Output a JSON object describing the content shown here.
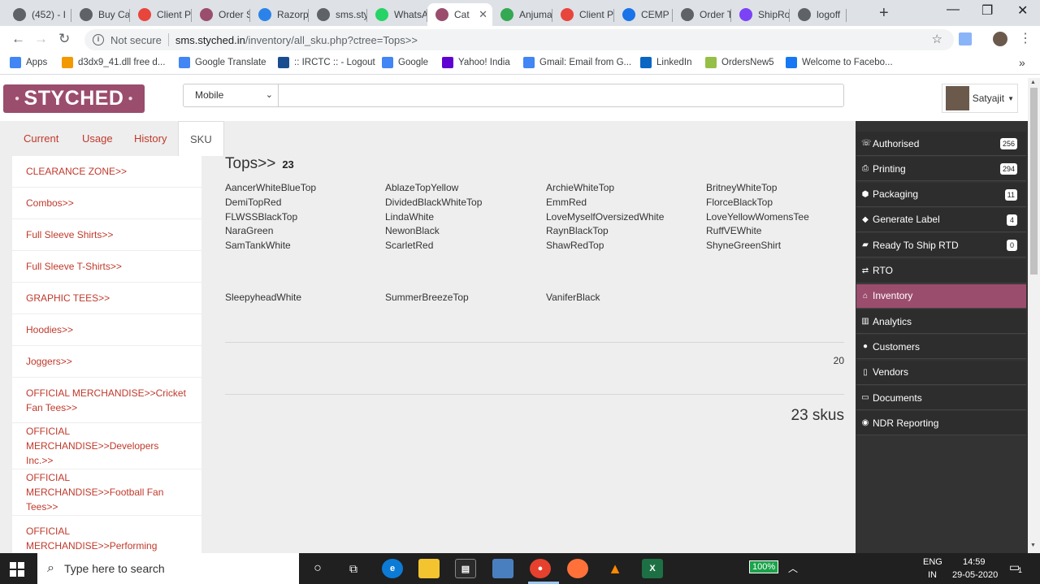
{
  "browser": {
    "tabs": [
      {
        "title": "(452) - I",
        "icon": "mail-icon",
        "color": "#5f6368"
      },
      {
        "title": "Buy Cas",
        "icon": "globe-icon",
        "color": "#5f6368"
      },
      {
        "title": "Client P",
        "icon": "client-icon",
        "color": "#e8453c"
      },
      {
        "title": "Order S",
        "icon": "styched-icon",
        "color": "#9b4d6d"
      },
      {
        "title": "Razorpa",
        "icon": "razorpay-icon",
        "color": "#2b83ea"
      },
      {
        "title": "sms.sty",
        "icon": "globe-icon",
        "color": "#5f6368"
      },
      {
        "title": "WhatsA",
        "icon": "whatsapp-icon",
        "color": "#25d366"
      },
      {
        "title": "Cat",
        "icon": "styched-icon",
        "color": "#9b4d6d"
      },
      {
        "title": "Anjuma",
        "icon": "maps-pin-icon",
        "color": "#34a853"
      },
      {
        "title": "Client P",
        "icon": "client-icon",
        "color": "#e8453c"
      },
      {
        "title": "CEMP",
        "icon": "cemp-icon",
        "color": "#1a73e8"
      },
      {
        "title": "Order T",
        "icon": "globe-icon",
        "color": "#5f6368"
      },
      {
        "title": "ShipRo",
        "icon": "shiprocket-icon",
        "color": "#7b42f6"
      },
      {
        "title": "logoff",
        "icon": "globe-icon",
        "color": "#5f6368"
      }
    ],
    "new_tab": "+",
    "window_controls": {
      "minimize": "—",
      "maximize": "❐",
      "close": "✕"
    },
    "address": {
      "not_secure": "Not secure",
      "host": "sms.styched.in",
      "path": "/inventory/all_sku.php?ctree=Tops>>"
    },
    "bookmarks": [
      {
        "label": "Apps",
        "icon": "apps-grid-icon",
        "color": "#4285f4"
      },
      {
        "label": "d3dx9_41.dll free d...",
        "icon": "gear-icon",
        "color": "#f29900"
      },
      {
        "label": "Google Translate",
        "icon": "translate-icon",
        "color": "#4285f4"
      },
      {
        "label": ":: IRCTC :: - Logout",
        "icon": "irctc-icon",
        "color": "#1a4d8f"
      },
      {
        "label": "Google",
        "icon": "google-icon",
        "color": "#4285f4"
      },
      {
        "label": "Yahoo! India",
        "icon": "yahoo-icon",
        "color": "#5f01d1"
      },
      {
        "label": "Gmail: Email from G...",
        "icon": "google-icon",
        "color": "#4285f4"
      },
      {
        "label": "LinkedIn",
        "icon": "linkedin-icon",
        "color": "#0a66c2"
      },
      {
        "label": "OrdersNew5",
        "icon": "shopify-icon",
        "color": "#95bf47"
      },
      {
        "label": "Welcome to Facebo...",
        "icon": "facebook-icon",
        "color": "#1877f2"
      }
    ],
    "more_bookmarks": "»"
  },
  "app": {
    "logo": "STYCHED",
    "search_type": "Mobile",
    "search_value": "",
    "user_name": "Satyajit"
  },
  "nav_tabs": [
    "Current",
    "Usage",
    "History",
    "SKU List"
  ],
  "categories": [
    "CLEARANCE ZONE>>",
    "Combos>>",
    "Full Sleeve Shirts>>",
    "Full Sleeve T-Shirts>>",
    "GRAPHIC TEES>>",
    "Hoodies>>",
    "Joggers>>",
    "OFFICIAL MERCHANDISE>>Cricket Fan Tees>>",
    "OFFICIAL MERCHANDISE>>Developers Inc.>>",
    "OFFICIAL MERCHANDISE>>Football Fan Tees>>",
    "OFFICIAL MERCHANDISE>>Performing"
  ],
  "sku_panel": {
    "title": "Tops>>",
    "count": "23",
    "group1": [
      "AancerWhiteBlueTop",
      "AblazeTopYellow",
      "ArchieWhiteTop",
      "BritneyWhiteTop",
      "DemiTopRed",
      "DividedBlackWhiteTop",
      "EmmRed",
      "FlorceBlackTop",
      "FLWSSBlackTop",
      "LindaWhite",
      "LoveMyselfOversizedWhite",
      "LoveYellowWomensTee",
      "NaraGreen",
      "NewonBlack",
      "RaynBlackTop",
      "RuffVEWhite",
      "SamTankWhite",
      "ScarletRed",
      "ShawRedTop",
      "ShyneGreenShirt"
    ],
    "group1_count": "20",
    "group2": [
      "SleepyheadWhite",
      "SummerBreezeTop",
      "VaniferBlack"
    ],
    "total": "23 skus"
  },
  "sidebar": [
    {
      "label": "Authorised",
      "icon": "phone-icon",
      "badge": "256"
    },
    {
      "label": "Printing",
      "icon": "printer-icon",
      "badge": "294"
    },
    {
      "label": "Packaging",
      "icon": "cubes-icon",
      "badge": "11"
    },
    {
      "label": "Generate Label",
      "icon": "tag-icon",
      "badge": "4"
    },
    {
      "label": "Ready To Ship RTD",
      "icon": "truck-icon",
      "badge": "0"
    },
    {
      "label": "RTO",
      "icon": "exchange-icon",
      "badge": null
    },
    {
      "label": "Inventory",
      "icon": "home-icon",
      "badge": null
    },
    {
      "label": "Analytics",
      "icon": "barcode-icon",
      "badge": null
    },
    {
      "label": "Customers",
      "icon": "user-icon",
      "badge": null
    },
    {
      "label": "Vendors",
      "icon": "file-icon",
      "badge": null
    },
    {
      "label": "Documents",
      "icon": "credit-card-icon",
      "badge": null
    },
    {
      "label": "NDR Reporting",
      "icon": "user-secret-icon",
      "badge": null
    }
  ],
  "sidebar_active": "Inventory",
  "taskbar": {
    "search_placeholder": "Type here to search",
    "battery": "100%",
    "lang": "ENG",
    "region": "IN",
    "time": "14:59",
    "date": "29-05-2020",
    "notifications": "1"
  },
  "colors": {
    "accent": "#9b4d6d",
    "link": "#c0392b",
    "sidebar": "#333333"
  }
}
